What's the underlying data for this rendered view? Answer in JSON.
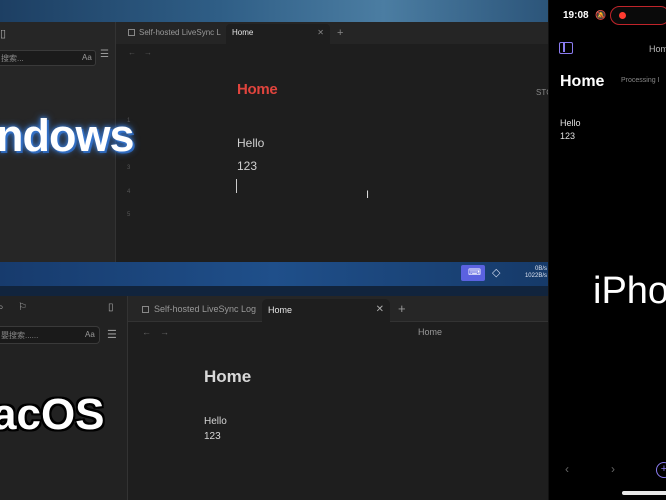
{
  "windows": {
    "label": "ndows",
    "search_placeholder": "搜索...",
    "search_case_label": "Aa",
    "tabs": [
      {
        "label": "Self-hosted LiveSync L"
      },
      {
        "label": "Home"
      }
    ],
    "note_title": "Home",
    "right_cut_label": "STC",
    "line_numbers": [
      "1",
      "2",
      "3",
      "4",
      "5"
    ],
    "lines": [
      "Hello",
      "123"
    ],
    "taskbar_speed": [
      "0B/s",
      "1022B/s"
    ],
    "accent_color": "#e0443d"
  },
  "mac": {
    "label": "acOS",
    "search_placeholder": "嬰搜索......",
    "search_case_label": "Aa",
    "tabs": [
      {
        "label": "Self-hosted LiveSync Log"
      },
      {
        "label": "Home"
      }
    ],
    "breadcrumb": "Home",
    "note_title": "Home",
    "lines": [
      "Hello",
      "123"
    ]
  },
  "iphone": {
    "label": "iPho",
    "time": "19:08",
    "header_title": "Home",
    "note_title": "Home",
    "status": "Processing I",
    "lines": [
      "Hello",
      "123"
    ],
    "accent_color": "#8b7cf0"
  }
}
